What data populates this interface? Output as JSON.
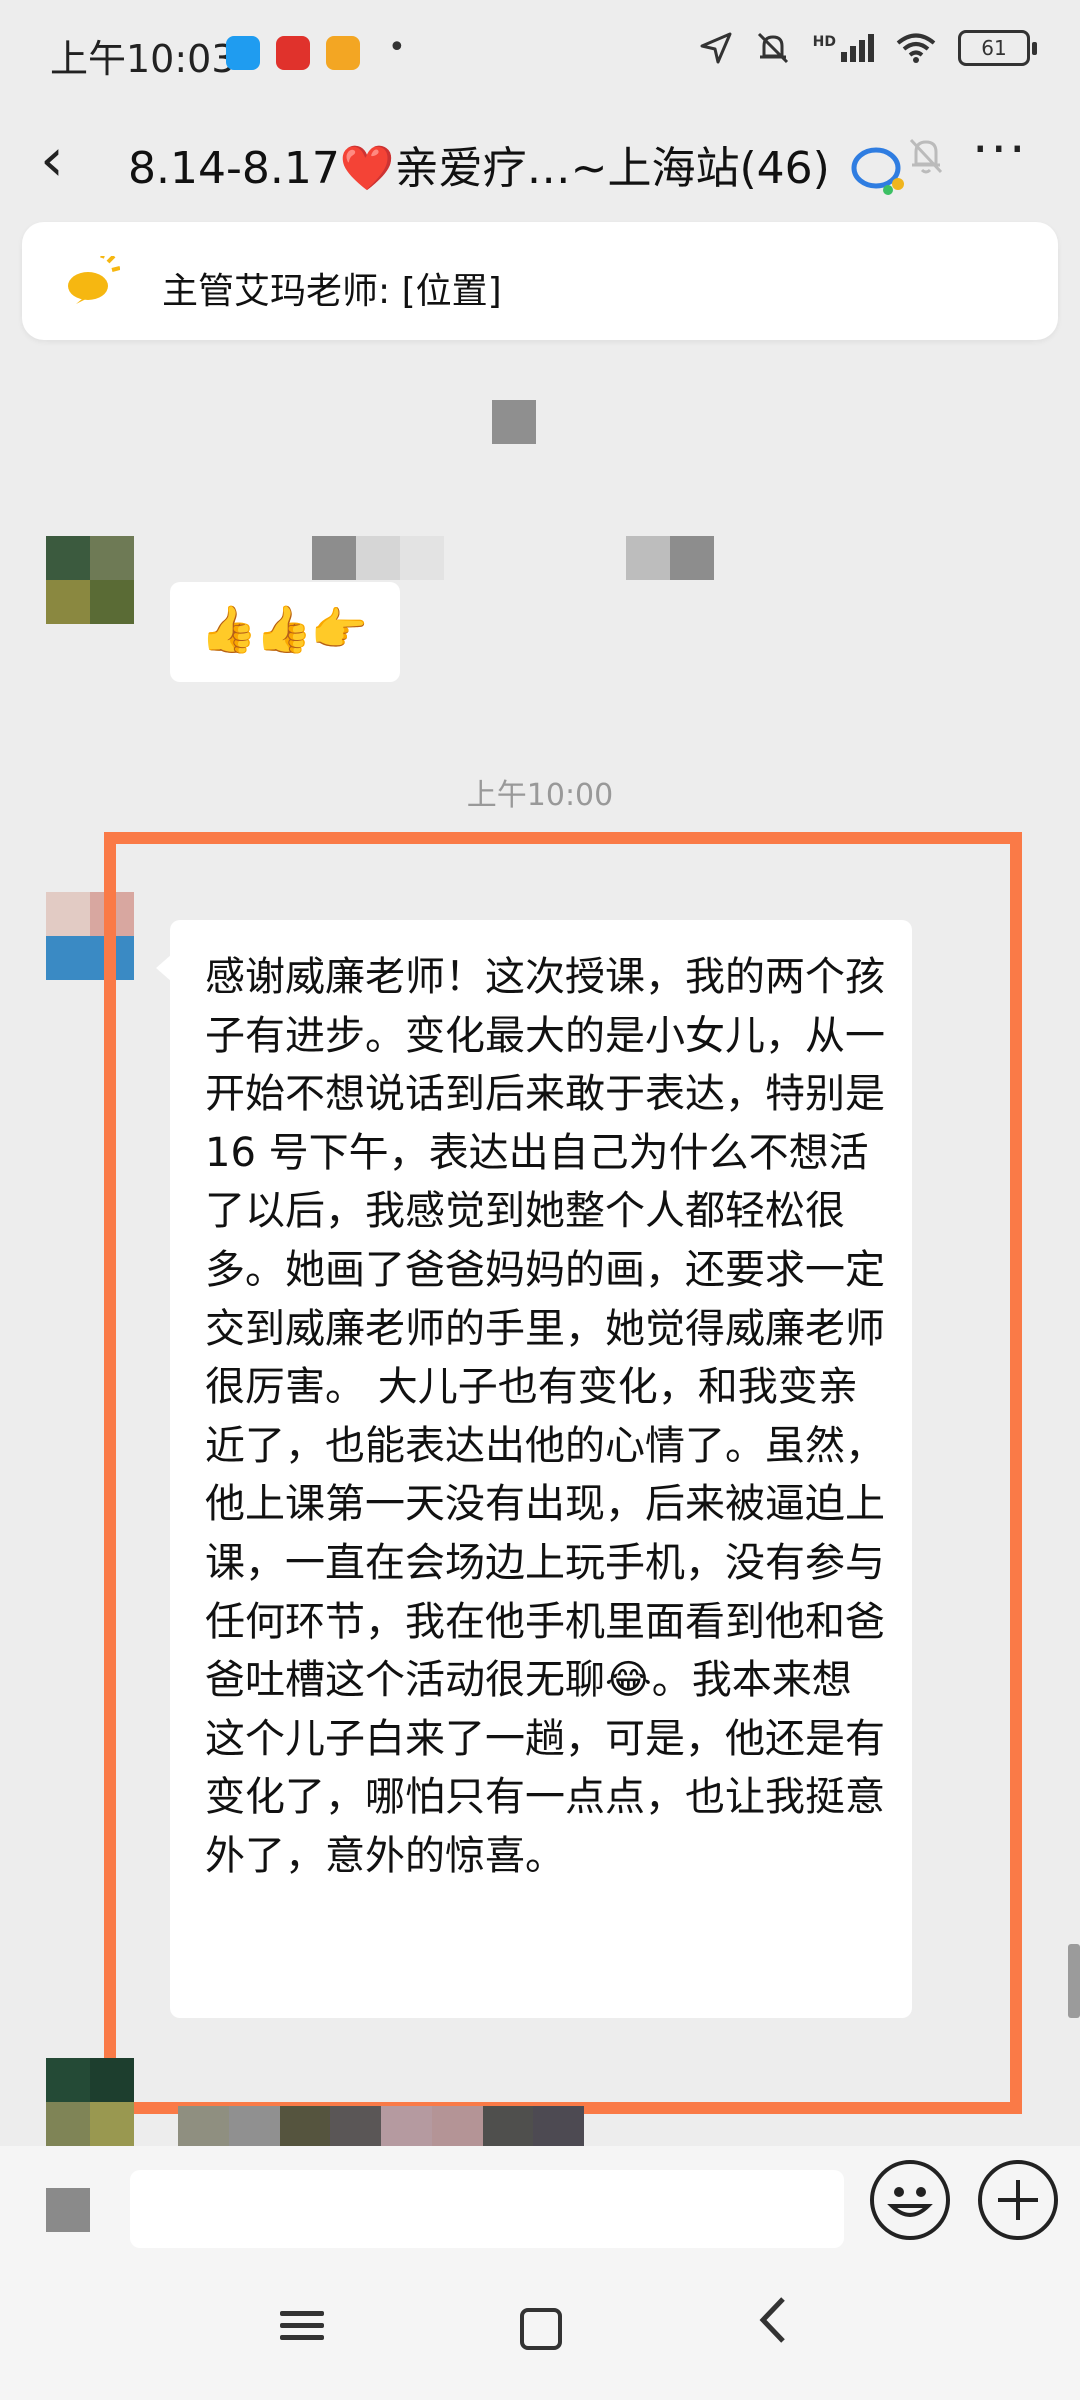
{
  "status_bar": {
    "time": "上午10:03",
    "hd": "HD",
    "battery": "61"
  },
  "nav": {
    "back_icon": "‹",
    "title_prefix": "8.14-8.17",
    "title_heart": "❤️",
    "title_suffix": "亲爱疗…~上海站(46)",
    "mute_icon": "mute-bell-icon",
    "more_label": "···"
  },
  "pinned": {
    "text": "主管艾玛老师: [位置]"
  },
  "messages": {
    "first_emoji": "👍👍👉",
    "time_divider": "上午10:00",
    "long_text": "感谢威廉老师！这次授课，我的两个孩子有进步。变化最大的是小女儿，从一开始不想说话到后来敢于表达，特别是 16 号下午，表达出自己为什么不想活了以后，我感觉到她整个人都轻松很多。她画了爸爸妈妈的画，还要求一定交到威廉老师的手里，她觉得威廉老师很厉害。 大儿子也有变化，和我变亲近了，也能表达出他的心情了。虽然，他上课第一天没有出现，后来被逼迫上课，一直在会场边上玩手机，没有参与任何环节，我在他手机里面看到他和爸爸吐槽这个活动很无聊😂。我本来想这个儿子白来了一趟，可是，他还是有变化了，哪怕只有一点点，也让我挺意外了，意外的惊喜。"
  },
  "input": {
    "placeholder": ""
  },
  "colors": {
    "highlight": "#fa7a47",
    "background": "#ededed",
    "heart": "#e5232e"
  }
}
